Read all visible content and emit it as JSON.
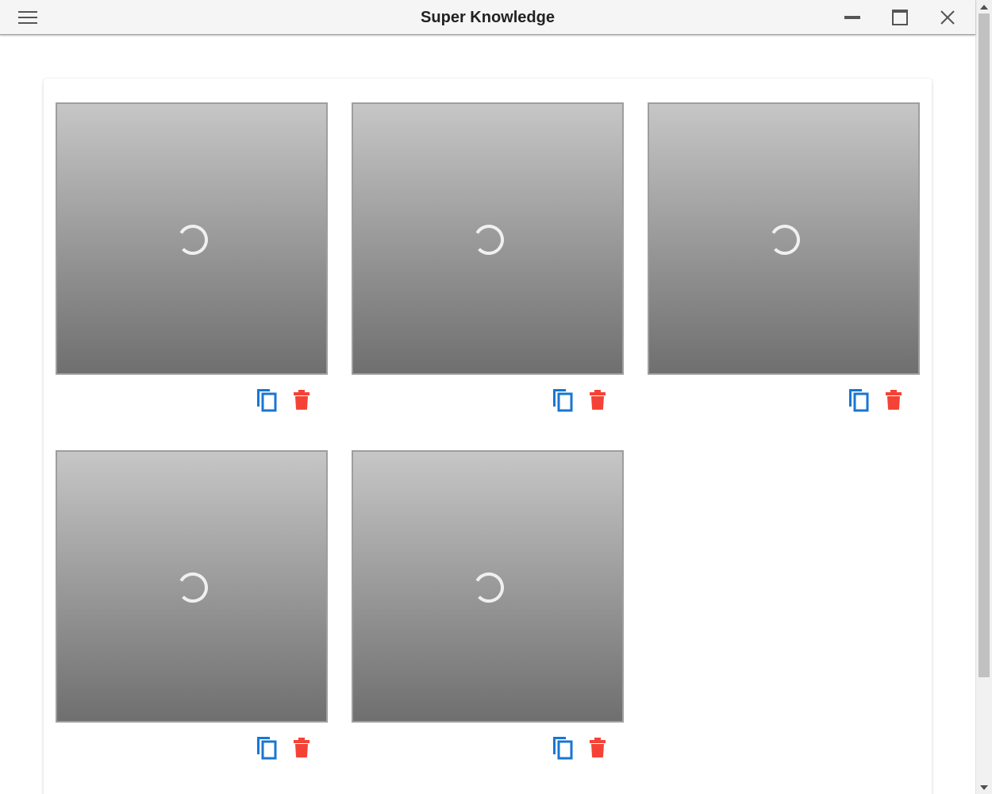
{
  "window": {
    "title": "Super Knowledge",
    "menu_icon": "hamburger-menu-icon",
    "controls": [
      "minimize-icon",
      "maximize-icon",
      "close-icon"
    ]
  },
  "colors": {
    "titlebar_bg": "#f5f5f5",
    "copy_icon": "#1976d2",
    "delete_icon": "#f44336",
    "spinner": "#f0f0f0"
  },
  "gallery": {
    "items": [
      {
        "state": "loading",
        "actions": [
          "copy-icon",
          "delete-icon"
        ]
      },
      {
        "state": "loading",
        "actions": [
          "copy-icon",
          "delete-icon"
        ]
      },
      {
        "state": "loading",
        "actions": [
          "copy-icon",
          "delete-icon"
        ]
      },
      {
        "state": "loading",
        "actions": [
          "copy-icon",
          "delete-icon"
        ]
      },
      {
        "state": "loading",
        "actions": [
          "copy-icon",
          "delete-icon"
        ]
      }
    ]
  }
}
